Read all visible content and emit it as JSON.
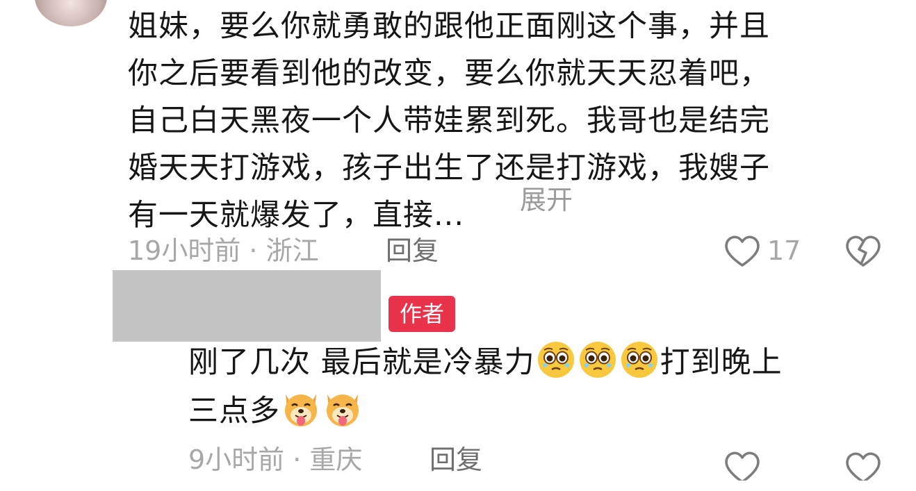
{
  "comment1": {
    "text": "姐妹，要么你就勇敢的跟他正面刚这个事，并且\n你之后要看到他的改变，要么你就天天忍着吧，\n自己白天黑夜一个人带娃累到死。我哥也是结完\n婚天天打游戏，孩子出生了还是打游戏，我嫂子\n有一天就爆发了，直接...",
    "expand_label": "展开",
    "meta": "19小时前 · 浙江",
    "reply_label": "回复",
    "like_count": "17"
  },
  "comment2": {
    "author_badge": "作者",
    "line1_a": "刚了几次 最后就是冷暴力",
    "line1_b": "打到晚上",
    "line2": "三点多",
    "meta": "9小时前 · 重庆",
    "reply_label": "回复"
  },
  "icons": {
    "like": "heart-outline-icon",
    "dislike": "broken-heart-icon",
    "emoji_1": "pleading-face-emoji",
    "emoji_2": "dog-tongue-emoji"
  },
  "colors": {
    "text": "#161616",
    "meta": "#a7a7a7",
    "badge": "#e8334a",
    "redaction": "#c4c4c4"
  }
}
